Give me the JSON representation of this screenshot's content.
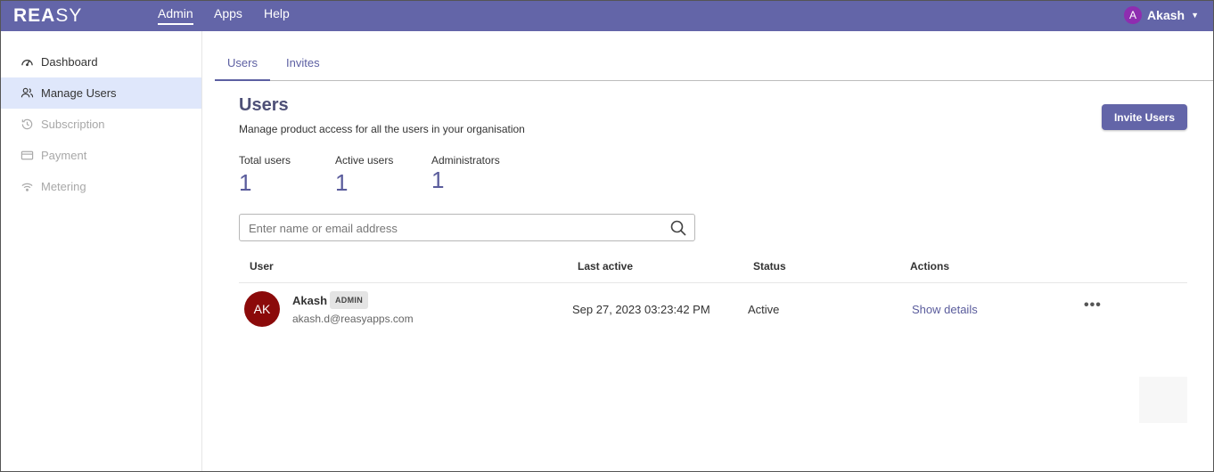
{
  "topbar": {
    "logo_bold": "REA",
    "logo_thin": "SY",
    "nav": [
      {
        "label": "Admin",
        "active": true
      },
      {
        "label": "Apps",
        "active": false
      },
      {
        "label": "Help",
        "active": false
      }
    ],
    "user": {
      "initial": "A",
      "name": "Akash",
      "caret": "▼"
    },
    "color": "#6365a8"
  },
  "sidebar": {
    "items": [
      {
        "label": "Dashboard",
        "icon": "gauge-icon",
        "state": "normal"
      },
      {
        "label": "Manage Users",
        "icon": "users-icon",
        "state": "active"
      },
      {
        "label": "Subscription",
        "icon": "history-icon",
        "state": "disabled"
      },
      {
        "label": "Payment",
        "icon": "credit-card-icon",
        "state": "disabled"
      },
      {
        "label": "Metering",
        "icon": "wifi-icon",
        "state": "disabled"
      }
    ]
  },
  "tabs": [
    {
      "label": "Users",
      "active": true
    },
    {
      "label": "Invites",
      "active": false
    }
  ],
  "page": {
    "title": "Users",
    "subtitle": "Manage product access for all the users in your organisation",
    "invite_button": "Invite Users"
  },
  "stats": [
    {
      "label": "Total users",
      "value": "1"
    },
    {
      "label": "Active users",
      "value": "1"
    },
    {
      "label": "Administrators",
      "value": "1"
    }
  ],
  "search": {
    "placeholder": "Enter name or email address",
    "value": ""
  },
  "table": {
    "columns": [
      "User",
      "Last active",
      "Status",
      "Actions"
    ],
    "rows": [
      {
        "initials": "AK",
        "name": "Akash",
        "role": "ADMIN",
        "email": "akash.d@reasyapps.com",
        "last_active": "Sep 27, 2023 03:23:42 PM",
        "status": "Active",
        "action": "Show details",
        "more": "•••"
      }
    ]
  }
}
